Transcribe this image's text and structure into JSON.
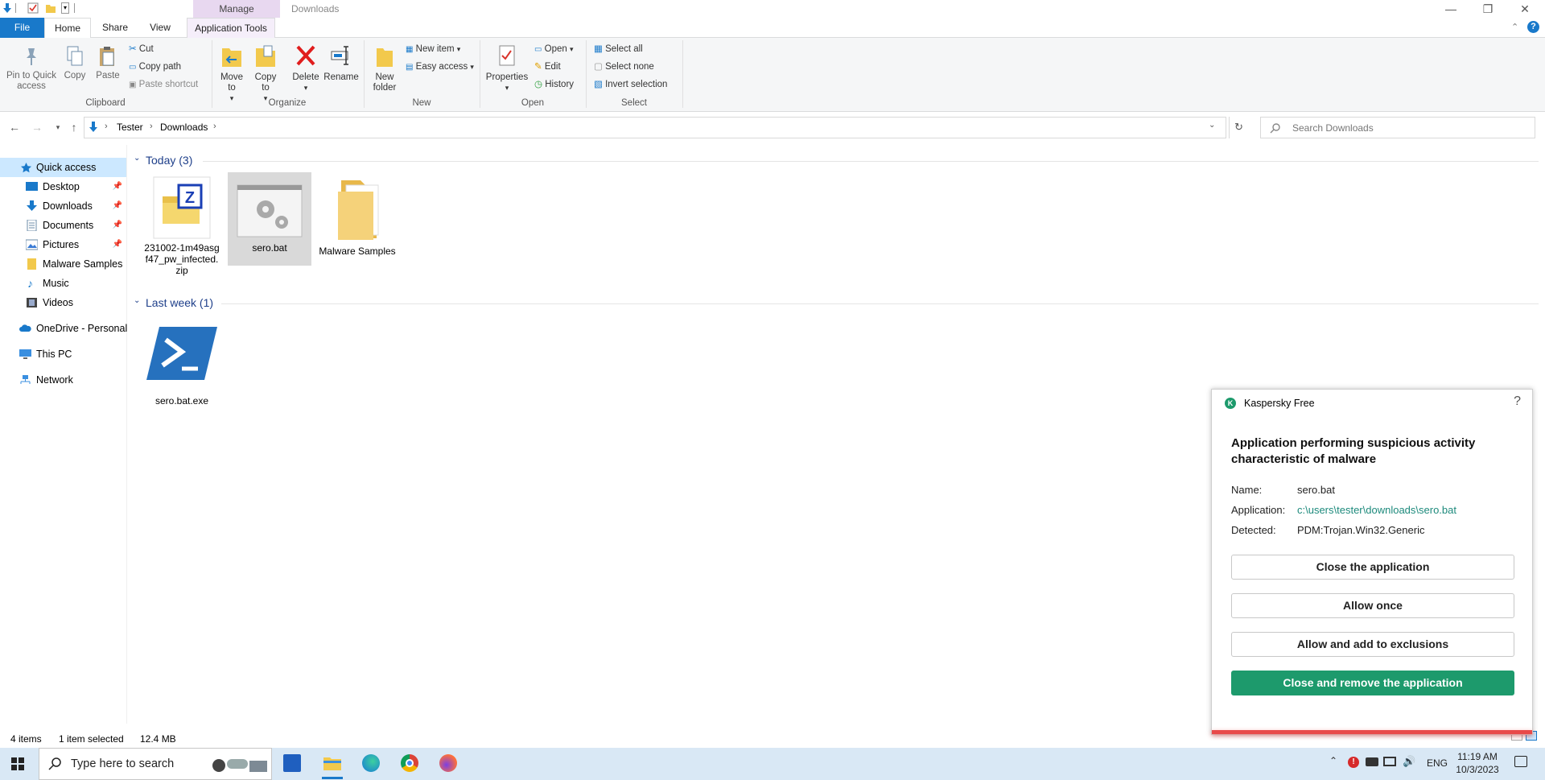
{
  "window": {
    "title": "Downloads",
    "manage_tab": "Manage"
  },
  "tabs": {
    "file": "File",
    "home": "Home",
    "share": "Share",
    "view": "View",
    "app_tools": "Application Tools"
  },
  "ribbon": {
    "clipboard": {
      "pin": "Pin to Quick access",
      "copy": "Copy",
      "paste": "Paste",
      "cut": "Cut",
      "copy_path": "Copy path",
      "paste_shortcut": "Paste shortcut",
      "label": "Clipboard"
    },
    "organize": {
      "move_to": "Move to",
      "copy_to": "Copy to",
      "delete": "Delete",
      "rename": "Rename",
      "label": "Organize"
    },
    "new": {
      "new_folder": "New folder",
      "new_item": "New item",
      "easy_access": "Easy access",
      "label": "New"
    },
    "open": {
      "properties": "Properties",
      "open": "Open",
      "edit": "Edit",
      "history": "History",
      "label": "Open"
    },
    "select": {
      "select_all": "Select all",
      "select_none": "Select none",
      "invert": "Invert selection",
      "label": "Select"
    }
  },
  "address": {
    "crumbs": [
      "Tester",
      "Downloads"
    ],
    "search_placeholder": "Search Downloads"
  },
  "sidebar": {
    "items": [
      {
        "label": "Quick access"
      },
      {
        "label": "Desktop"
      },
      {
        "label": "Downloads"
      },
      {
        "label": "Documents"
      },
      {
        "label": "Pictures"
      },
      {
        "label": "Malware Samples"
      },
      {
        "label": "Music"
      },
      {
        "label": "Videos"
      },
      {
        "label": "OneDrive - Personal"
      },
      {
        "label": "This PC"
      },
      {
        "label": "Network"
      }
    ]
  },
  "groups": {
    "today": {
      "label": "Today (3)",
      "files": [
        "231002-1m49asgf47_pw_infected.zip",
        "sero.bat",
        "Malware Samples"
      ]
    },
    "last_week": {
      "label": "Last week (1)",
      "files": [
        "sero.bat.exe"
      ]
    }
  },
  "status": {
    "items": "4 items",
    "selected": "1 item selected",
    "size": "12.4 MB"
  },
  "kaspersky": {
    "app_name": "Kaspersky Free",
    "help": "?",
    "heading": "Application performing suspicious activity characteristic of malware",
    "name_label": "Name:",
    "name_value": "sero.bat",
    "app_label": "Application:",
    "app_value": "c:\\users\\tester\\downloads\\sero.bat",
    "detected_label": "Detected:",
    "detected_value": "PDM:Trojan.Win32.Generic",
    "buttons": {
      "close": "Close the application",
      "allow_once": "Allow once",
      "allow_exclude": "Allow and add to exclusions",
      "remove": "Close and remove the application"
    },
    "accent": "#1d9a6c"
  },
  "taskbar": {
    "search_placeholder": "Type here to search",
    "lang": "ENG",
    "time": "11:19 AM",
    "date": "10/3/2023"
  }
}
